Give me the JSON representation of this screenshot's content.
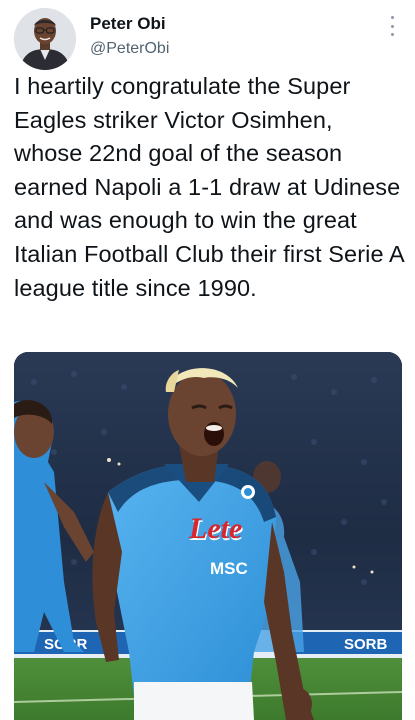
{
  "tweet": {
    "author_name": "Peter Obi",
    "author_handle": "@PeterObi",
    "text": "I heartily congratulate the Super Eagles striker Victor Osimhen, whose 22nd goal of the season earned Napoli a 1-1 draw at Udinese and was enough to win the great Italian Football Club their first Serie A league title since 1990."
  },
  "photo": {
    "jersey_sponsor": "Lete",
    "jersey_sponsor_secondary": "MSC",
    "board_text": "SORR"
  },
  "colors": {
    "name": "#0f1419",
    "handle": "#536471",
    "jersey_blue": "#3d9be0",
    "sponsor_red": "#d8262f"
  },
  "icons": [
    "more-vertical-icon"
  ]
}
